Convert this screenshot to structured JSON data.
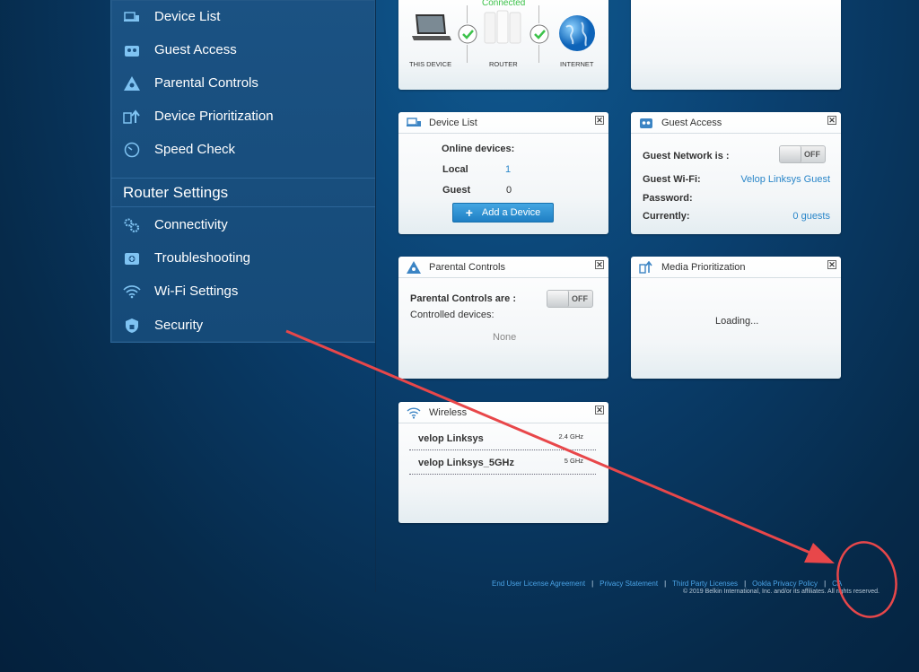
{
  "nav": {
    "items_top": [
      {
        "label": "Device List"
      },
      {
        "label": "Guest Access"
      },
      {
        "label": "Parental Controls"
      },
      {
        "label": "Device Prioritization"
      },
      {
        "label": "Speed Check"
      }
    ],
    "heading": "Router Settings",
    "items_settings": [
      {
        "label": "Connectivity"
      },
      {
        "label": "Troubleshooting"
      },
      {
        "label": "Wi-Fi Settings"
      },
      {
        "label": "Security"
      }
    ]
  },
  "network_map": {
    "status": "Connected",
    "this_device": "THIS DEVICE",
    "router": "ROUTER",
    "internet": "INTERNET"
  },
  "device_list": {
    "title": "Device List",
    "online_label": "Online devices:",
    "local_label": "Local",
    "local_value": "1",
    "guest_label": "Guest",
    "guest_value": "0",
    "add_button": "Add a Device"
  },
  "guest_access": {
    "title": "Guest Access",
    "network_label": "Guest Network is :",
    "toggle": "OFF",
    "wifi_label": "Guest Wi-Fi:",
    "wifi_value": "Velop Linksys Guest",
    "password_label": "Password:",
    "currently_label": "Currently:",
    "currently_value": "0 guests"
  },
  "parental_controls": {
    "title": "Parental Controls",
    "status_label": "Parental Controls are :",
    "toggle": "OFF",
    "controlled_label": "Controlled devices:",
    "none": "None"
  },
  "media_prioritization": {
    "title": "Media Prioritization",
    "loading": "Loading..."
  },
  "wireless": {
    "title": "Wireless",
    "networks": [
      {
        "name": "velop Linksys",
        "band": "2.4 GHz"
      },
      {
        "name": "velop Linksys_5GHz",
        "band": "5 GHz"
      }
    ]
  },
  "footer": {
    "links": [
      "End User License Agreement",
      "Privacy Statement",
      "Third Party Licenses",
      "Ookla Privacy Policy",
      "CA"
    ],
    "copyright": "© 2019 Belkin International, Inc. and/or its affiliates. All rights reserved."
  },
  "colors": {
    "annotation_red": "#e8474a",
    "link_blue": "#2a86c9",
    "connected_green": "#3cc24a"
  },
  "icons": [
    "device-list-icon",
    "guest-access-icon",
    "parental-controls-icon",
    "device-prioritization-icon",
    "speed-check-icon",
    "connectivity-icon",
    "troubleshooting-icon",
    "wifi-icon",
    "security-icon",
    "laptop-icon",
    "router-icon",
    "globe-icon",
    "check-icon",
    "close-icon",
    "plus-icon"
  ]
}
